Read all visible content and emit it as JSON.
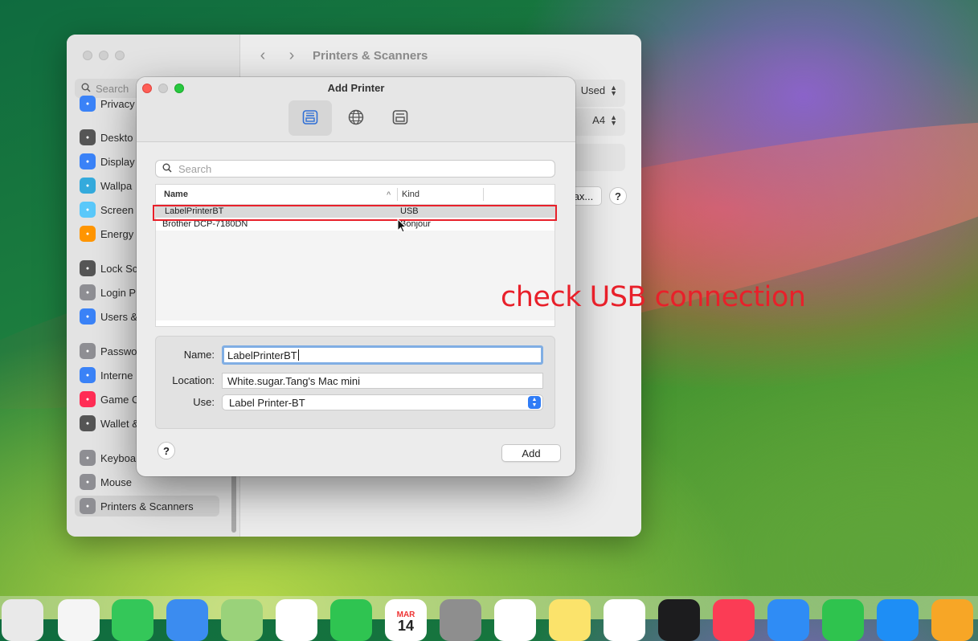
{
  "settings": {
    "search_placeholder": "Search",
    "title": "Printers & Scanners",
    "sidebar": [
      {
        "label": "Privacy",
        "icon": "hand-icon",
        "color": "#3a82f7"
      },
      {
        "label": "Deskto",
        "icon": "desktop-icon",
        "color": "#555555"
      },
      {
        "label": "Display",
        "icon": "sun-icon",
        "color": "#3a82f7"
      },
      {
        "label": "Wallpa",
        "icon": "wallpaper-icon",
        "color": "#34aadc"
      },
      {
        "label": "Screen",
        "icon": "screensaver-icon",
        "color": "#5ac8fa"
      },
      {
        "label": "Energy",
        "icon": "energy-icon",
        "color": "#ff9500"
      },
      {
        "label": "Lock Sc",
        "icon": "lock-icon",
        "color": "#555555"
      },
      {
        "label": "Login P",
        "icon": "login-icon",
        "color": "#8e8e93"
      },
      {
        "label": "Users &",
        "icon": "users-icon",
        "color": "#3a82f7"
      },
      {
        "label": "Passwo",
        "icon": "key-icon",
        "color": "#8e8e93"
      },
      {
        "label": "Interne",
        "icon": "at-icon",
        "color": "#3a82f7"
      },
      {
        "label": "Game C",
        "icon": "gamecenter-icon",
        "color": "#ff2d55"
      },
      {
        "label": "Wallet &",
        "icon": "wallet-icon",
        "color": "#555555"
      },
      {
        "label": "Keyboa",
        "icon": "keyboard-icon",
        "color": "#8e8e93"
      },
      {
        "label": "Mouse",
        "icon": "mouse-icon",
        "color": "#8e8e93"
      },
      {
        "label": "Printers & Scanners",
        "icon": "printer-icon",
        "color": "#8e8e93"
      }
    ],
    "default_paper_value": "Used",
    "paper_size_value": "A4",
    "fax_button_label": "ax...",
    "help_label": "?"
  },
  "dialog": {
    "title": "Add Printer",
    "search_placeholder": "Search",
    "columns": {
      "name": "Name",
      "kind": "Kind"
    },
    "rows": [
      {
        "name": "LabelPrinterBT",
        "kind": "USB"
      },
      {
        "name": "Brother DCP-7180DN",
        "kind": "Bonjour"
      }
    ],
    "form": {
      "name_label": "Name:",
      "name_value": "LabelPrinterBT",
      "location_label": "Location:",
      "location_value": "White.sugar.Tang's Mac mini",
      "use_label": "Use:",
      "use_value": "Label Printer-BT"
    },
    "help_label": "?",
    "add_label": "Add"
  },
  "annotation": "check USB connection",
  "dock": {
    "calendar_month": "MAR",
    "calendar_day": "14"
  },
  "colors": {
    "highlight": "#e8202a",
    "accent": "#2f7cf6"
  }
}
